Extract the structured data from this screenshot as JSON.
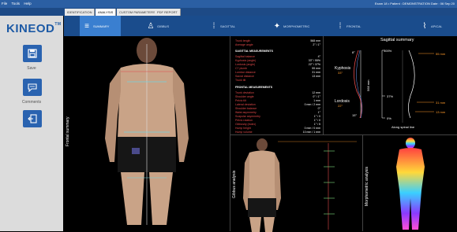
{
  "menubar": {
    "items": [
      "File",
      "Tools",
      "Help"
    ],
    "status": "Exam 18 • Patient : DEMONSTRATION Date : 06 Sep 20"
  },
  "tabs": [
    "IDENTIFICATION",
    "ANALYSIS",
    "CUSTOM PARAMETERS",
    "PDF REPORT"
  ],
  "sidebar": {
    "logo": "KINEOD",
    "logo_mark": "TM",
    "save_label": "Save",
    "comments_label": "Comments"
  },
  "subtabs": [
    "SUMMARY",
    "GIBBUS",
    "SAGITTAL",
    "MORPHOMETRIC",
    "FRONTAL",
    "APICAL"
  ],
  "panes": {
    "frontal": "Frontal summary",
    "sagittal_title": "Sagittal summary",
    "gibbus": "Gibbus analysis",
    "morpho": "Morphometric analysis"
  },
  "sagittal_chart": {
    "kyphosis_label": "Kyphosis",
    "kyphosis_value": "33°",
    "lordosis_label": "Lordosis",
    "lordosis_value": "22°",
    "length": "568 mm",
    "pct_top": "100%",
    "pct_mid": "37%",
    "pct_bottom": "0%",
    "right_top": "55 mm",
    "right_mid": "31 mm",
    "right_bottom": "13 mm",
    "axis_label": "Along spinal line",
    "top_angle": "8°",
    "bottom_angle": "15°"
  },
  "measurements": {
    "top": [
      {
        "k": "Trunk length",
        "v": "568 mm"
      },
      {
        "k": "Average angle",
        "v": "2° / 1°"
      }
    ],
    "sag_header": "SAGITTAL MEASUREMENTS",
    "sagittal": [
      {
        "k": "Sagittal balance",
        "v": "4°"
      },
      {
        "k": "Kyphosis (angle)",
        "v": "33° / 55%"
      },
      {
        "k": "Lordosis (angle)",
        "v": "22° / 37%"
      },
      {
        "k": "C7 plumb",
        "v": "55 mm"
      },
      {
        "k": "Lumbar distance",
        "v": "31 mm"
      },
      {
        "k": "Sacral distance",
        "v": "13 mm"
      },
      {
        "k": "Trunk tilt",
        "v": ""
      }
    ],
    "front_header": "FRONTAL MEASUREMENTS",
    "frontal": [
      {
        "k": "Trunk deviation",
        "v": "12 mm"
      },
      {
        "k": "Shoulder angle",
        "v": "0° / 1°"
      },
      {
        "k": "Pelvic tilt",
        "v": "1 mm"
      },
      {
        "k": "Lateral deviation",
        "v": "0 mm / 2 mm"
      },
      {
        "k": "Shoulder balance",
        "v": "0°"
      },
      {
        "k": "Waist asymmetry",
        "v": "1°"
      },
      {
        "k": "Scapular asymmetry",
        "v": "1° / 0"
      },
      {
        "k": "Pelvic rotation",
        "v": "1° / 0"
      },
      {
        "k": "Gibbosity (index)",
        "v": "1° / 5"
      },
      {
        "k": "Hump height",
        "v": "0 mm / 0 mm"
      },
      {
        "k": "Hump volume",
        "v": "10 mm / 1 mm"
      }
    ]
  },
  "colors": {
    "menubar": "#2b5fa3",
    "accent": "#3a7fd0",
    "sidebar": "#dcdcdc",
    "button": "#2a63b0"
  },
  "icons": [
    "save-icon",
    "comments-icon",
    "exit-icon",
    "summary-icon",
    "body-icon",
    "spine-icon"
  ]
}
